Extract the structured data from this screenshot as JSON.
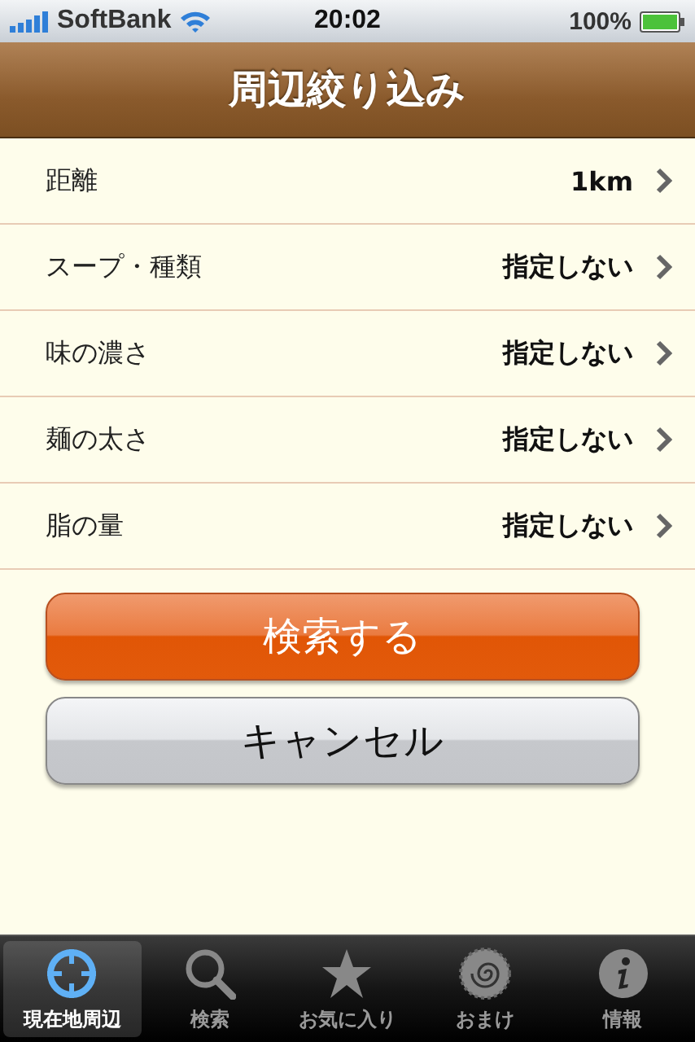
{
  "status_bar": {
    "carrier": "SoftBank",
    "time": "20:02",
    "battery": "100%"
  },
  "nav": {
    "title": "周辺絞り込み"
  },
  "rows": [
    {
      "label": "距離",
      "value": "1km"
    },
    {
      "label": "スープ・種類",
      "value": "指定しない"
    },
    {
      "label": "味の濃さ",
      "value": "指定しない"
    },
    {
      "label": "麺の太さ",
      "value": "指定しない"
    },
    {
      "label": "脂の量",
      "value": "指定しない"
    }
  ],
  "buttons": [
    {
      "label": "検索する",
      "kind": "primary"
    },
    {
      "label": "キャンセル",
      "kind": "secondary"
    }
  ],
  "tabs": [
    {
      "label": "現在地周辺",
      "kind": "locate",
      "selected": true
    },
    {
      "label": "検索",
      "kind": "search",
      "selected": false
    },
    {
      "label": "お気に入り",
      "kind": "star",
      "selected": false
    },
    {
      "label": "おまけ",
      "kind": "spiral",
      "selected": false
    },
    {
      "label": "情報",
      "kind": "info",
      "selected": false
    }
  ]
}
